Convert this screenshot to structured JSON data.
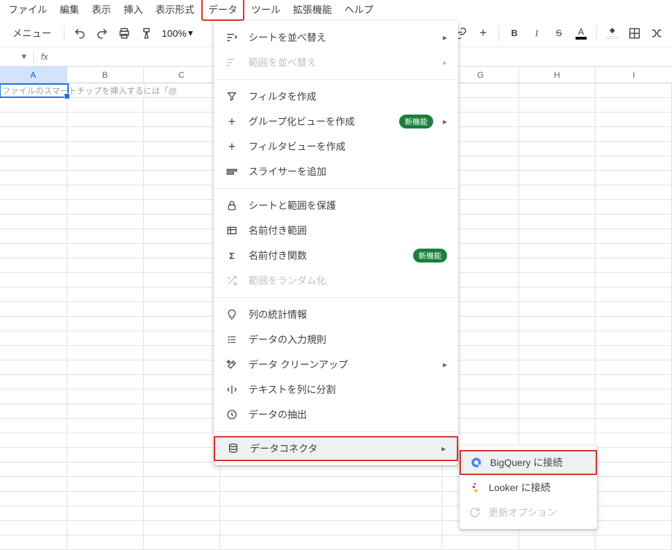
{
  "menubar": {
    "file": "ファイル",
    "edit": "編集",
    "view": "表示",
    "insert": "挿入",
    "format": "表示形式",
    "data": "データ",
    "tools": "ツール",
    "extensions": "拡張機能",
    "help": "ヘルプ"
  },
  "toolbar": {
    "menus": "メニュー",
    "zoom": "100%"
  },
  "fx": {
    "fx_label": "fx"
  },
  "columns": [
    "A",
    "B",
    "C",
    "G",
    "H",
    "I"
  ],
  "cell_hint": "ファイルのスマートチップを挿入するには「@",
  "data_menu": {
    "sort_sheet": "シートを並べ替え",
    "sort_range": "範囲を並べ替え",
    "create_filter": "フィルタを作成",
    "group_view": "グループ化ビューを作成",
    "filter_view": "フィルタビューを作成",
    "add_slicer": "スライサーを追加",
    "protect": "シートと範囲を保護",
    "named_ranges": "名前付き範囲",
    "named_functions": "名前付き関数",
    "randomize": "範囲をランダム化",
    "column_stats": "列の統計情報",
    "data_validation": "データの入力規則",
    "data_cleanup": "データ クリーンアップ",
    "split_text": "テキストを列に分割",
    "data_extraction": "データの抽出",
    "data_connectors": "データコネクタ",
    "new_badge": "新機能"
  },
  "submenu": {
    "bigquery": "BigQuery に接続",
    "looker": "Looker に接続",
    "refresh": "更新オプション"
  }
}
